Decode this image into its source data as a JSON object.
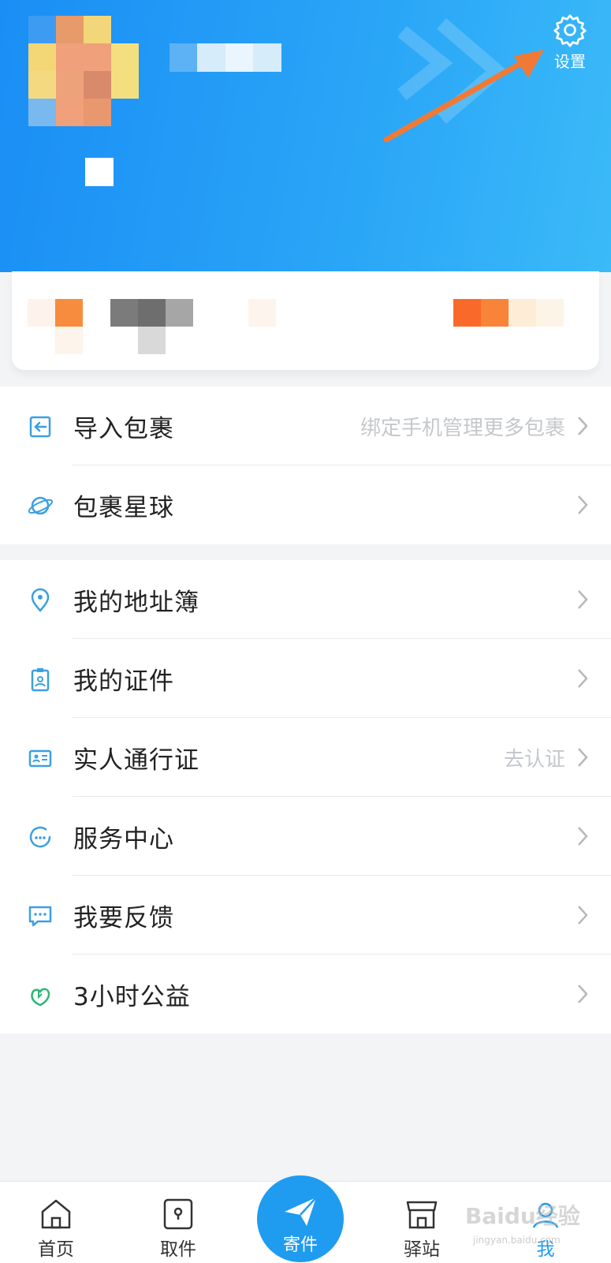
{
  "header": {
    "settings_label": "设置"
  },
  "colors": {
    "header_blue": "#1a8ef5",
    "accent": "#1f9bf0",
    "arrow": "#f07a35",
    "icon_teal": "#3aa0e0",
    "icon_green": "#2bb673"
  },
  "menu_group_1": [
    {
      "label": "导入包裹",
      "hint": "绑定手机管理更多包裹",
      "icon": "import-icon"
    },
    {
      "label": "包裹星球",
      "hint": "",
      "icon": "planet-icon"
    }
  ],
  "menu_group_2": [
    {
      "label": "我的地址簿",
      "hint": "",
      "icon": "location-pin-icon"
    },
    {
      "label": "我的证件",
      "hint": "",
      "icon": "id-badge-icon"
    },
    {
      "label": "实人通行证",
      "hint": "去认证",
      "icon": "id-card-icon"
    },
    {
      "label": "服务中心",
      "hint": "",
      "icon": "service-icon"
    },
    {
      "label": "我要反馈",
      "hint": "",
      "icon": "feedback-icon"
    },
    {
      "label": "3小时公益",
      "hint": "",
      "icon": "charity-icon"
    }
  ],
  "tabbar": {
    "home": "首页",
    "pickup": "取件",
    "send": "寄件",
    "station": "驿站",
    "me": "我"
  },
  "watermark": {
    "main": "Baidu经验",
    "sub": "jingyan.baidu.com"
  }
}
